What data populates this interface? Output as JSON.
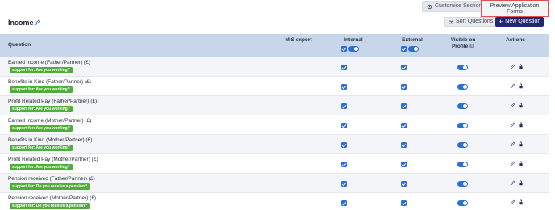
{
  "toolbar": {
    "customise_label": "Customise Sections",
    "preview_label": "Preview Application Forms"
  },
  "section": {
    "title": "Income",
    "sort_label": "Sort Questions",
    "new_label": "New Question"
  },
  "table": {
    "headers": {
      "question": "Question",
      "mis_export": "MIS export",
      "internal": "Internal",
      "external": "External",
      "visible": "Visible on Profile",
      "actions": "Actions"
    },
    "rows": [
      {
        "label": "Earned Income (Father/Partner) (£)",
        "tag": "support for: Are you working?"
      },
      {
        "label": "Benefits in Kind (Father/Partner) (£)",
        "tag": "support for: Are you working?"
      },
      {
        "label": "Profit Related Pay (Father/Partner) (£)",
        "tag": "support for: Are you working?"
      },
      {
        "label": "Earned Income (Mother/Partner) (£)",
        "tag": "support for: Are you working?"
      },
      {
        "label": "Benefits in Kind (Mother/Partner) (£)",
        "tag": "support for: Are you working?"
      },
      {
        "label": "Profit Related Pay (Mother/Partner) (£)",
        "tag": "support for: Are you working?"
      },
      {
        "label": "Pension received (Father/Partner) (£)",
        "tag": "support for: Do you receive a pension?"
      },
      {
        "label": "Pension received (Mother/Partner) (£)",
        "tag": "support for: Do you receive a pension?"
      }
    ]
  },
  "colors": {
    "header_bg": "#c7d6ea",
    "primary": "#1f2a6e",
    "toggle": "#2d6ed6",
    "tag": "#4fae3a",
    "highlight_border": "#e05050"
  }
}
